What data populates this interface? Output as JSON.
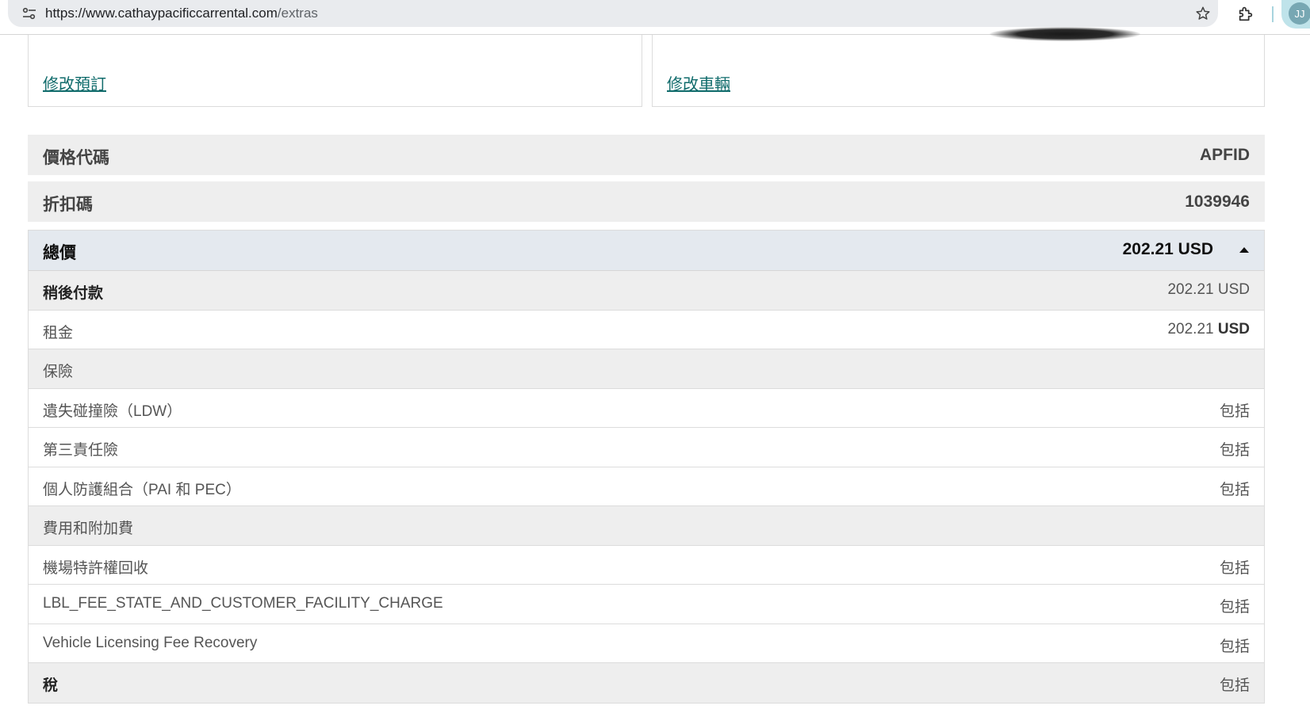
{
  "browser": {
    "url_host": "https://www.cathaypacificcarrental.com",
    "url_path": "/extras",
    "avatar_initials": "JJ"
  },
  "cards": {
    "modify_booking": "修改預訂",
    "modify_vehicle": "修改車輛"
  },
  "summary": {
    "rate_code_label": "價格代碼",
    "rate_code_value": "APFID",
    "discount_label": "折扣碼",
    "discount_value": "1039946"
  },
  "price": {
    "total_label": "總價",
    "total_value": "202.21 USD",
    "rows": [
      {
        "label": "稍後付款",
        "value": "202.21 USD"
      },
      {
        "label": "租金",
        "amount": "202.21",
        "currency": "USD"
      },
      {
        "label": "保險",
        "value": ""
      },
      {
        "label": "遺失碰撞險（LDW）",
        "value": "包括"
      },
      {
        "label": "第三責任險",
        "value": "包括"
      },
      {
        "label": "個人防護組合（PAI 和 PEC）",
        "value": "包括"
      },
      {
        "label": "費用和附加費",
        "value": ""
      },
      {
        "label": "機場特許權回收",
        "value": "包括"
      },
      {
        "label": "LBL_FEE_STATE_AND_CUSTOMER_FACILITY_CHARGE",
        "value": "包括"
      },
      {
        "label": "Vehicle Licensing Fee Recovery",
        "value": "包括"
      },
      {
        "label": "稅",
        "value": "包括"
      }
    ]
  }
}
